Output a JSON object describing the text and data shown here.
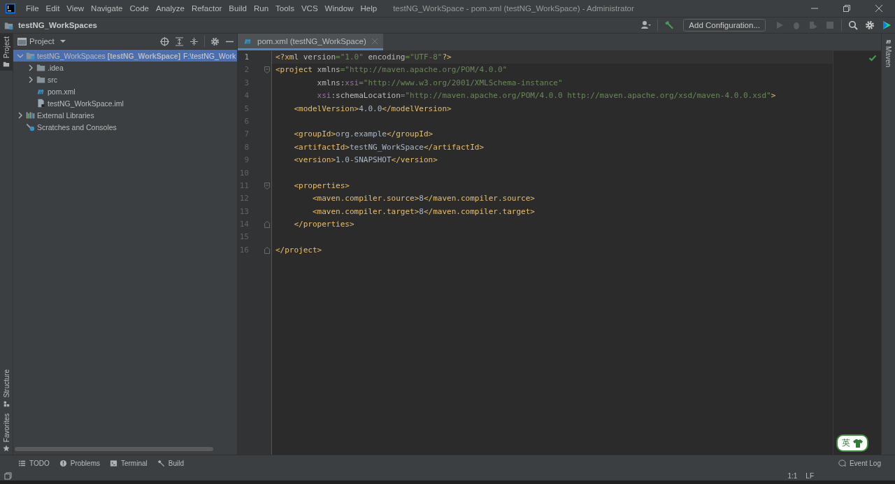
{
  "window": {
    "menu": [
      "File",
      "Edit",
      "View",
      "Navigate",
      "Code",
      "Analyze",
      "Refactor",
      "Build",
      "Run",
      "Tools",
      "VCS",
      "Window",
      "Help"
    ],
    "title": "testNG_WorkSpace - pom.xml (testNG_WorkSpace) - Administrator"
  },
  "navbar": {
    "project": "testNG_WorkSpaces",
    "run_config": "Add Configuration..."
  },
  "left_stripe": [
    {
      "label": "Project",
      "selected": true,
      "kind": "project"
    },
    {
      "label": "Structure",
      "selected": false,
      "kind": "structure"
    },
    {
      "label": "Favorites",
      "selected": false,
      "kind": "favorites"
    }
  ],
  "project_panel": {
    "title": "Project",
    "tree": [
      {
        "name": "testNG_WorkSpaces",
        "module": "[testNG_WorkSpace]",
        "path": "F:\\testNG_Work",
        "kind": "module",
        "expanded": true,
        "selected": true,
        "children": [
          {
            "name": ".idea",
            "kind": "folder",
            "expanded": false,
            "selected": false
          },
          {
            "name": "src",
            "kind": "folder",
            "expanded": false,
            "selected": false
          },
          {
            "name": "pom.xml",
            "kind": "maven",
            "selected": false
          },
          {
            "name": "testNG_WorkSpace.iml",
            "kind": "file",
            "selected": false
          }
        ]
      },
      {
        "name": "External Libraries",
        "kind": "libraries",
        "expanded": false,
        "selected": false
      },
      {
        "name": "Scratches and Consoles",
        "kind": "scratches",
        "selected": false
      }
    ]
  },
  "editor": {
    "tabs": [
      {
        "label": "pom.xml (testNG_WorkSpace)",
        "selected": true
      }
    ],
    "lines": [
      {
        "number": "1",
        "kind": "plain",
        "current": true,
        "tokens": [
          {
            "kind": "tag",
            "text": "<?xml "
          },
          {
            "kind": "attr",
            "text": "version"
          },
          {
            "kind": "str",
            "text": "=\"1.0\""
          },
          {
            "kind": "attr",
            "text": " encoding"
          },
          {
            "kind": "str",
            "text": "=\"UTF-8\""
          },
          {
            "kind": "tag",
            "text": "?>"
          }
        ]
      },
      {
        "number": "2",
        "kind": "fold-start",
        "current": false,
        "tokens": [
          {
            "kind": "tag",
            "text": "<project "
          },
          {
            "kind": "attr",
            "text": "xmlns"
          },
          {
            "kind": "str",
            "text": "=\"http://maven.apache.org/POM/4.0.0\""
          }
        ]
      },
      {
        "number": "3",
        "kind": "plain",
        "current": false,
        "tokens": [
          {
            "kind": "attr",
            "text": "         xmlns:"
          },
          {
            "kind": "ns",
            "text": "xsi"
          },
          {
            "kind": "str",
            "text": "=\"http://www.w3.org/2001/XMLSchema-instance\""
          }
        ]
      },
      {
        "number": "4",
        "kind": "plain",
        "current": false,
        "tokens": [
          {
            "kind": "ns",
            "text": "         xsi"
          },
          {
            "kind": "attr",
            "text": ":schemaLocation"
          },
          {
            "kind": "str",
            "text": "=\"http://maven.apache.org/POM/4.0.0 http://maven.apache.org/xsd/maven-4.0.0.xsd\""
          },
          {
            "kind": "tag",
            "text": ">"
          }
        ]
      },
      {
        "number": "5",
        "kind": "plain",
        "current": false,
        "tokens": [
          {
            "kind": "tag",
            "text": "    <modelVersion>"
          },
          {
            "kind": "text",
            "text": "4.0.0"
          },
          {
            "kind": "tag",
            "text": "</modelVersion>"
          }
        ]
      },
      {
        "number": "6",
        "kind": "plain",
        "current": false
      },
      {
        "number": "7",
        "kind": "plain",
        "current": false,
        "tokens": [
          {
            "kind": "tag",
            "text": "    <groupId>"
          },
          {
            "kind": "text",
            "text": "org.example"
          },
          {
            "kind": "tag",
            "text": "</groupId>"
          }
        ]
      },
      {
        "number": "8",
        "kind": "plain",
        "current": false,
        "tokens": [
          {
            "kind": "tag",
            "text": "    <artifactId>"
          },
          {
            "kind": "text",
            "text": "testNG_WorkSpace"
          },
          {
            "kind": "tag",
            "text": "</artifactId>"
          }
        ]
      },
      {
        "number": "9",
        "kind": "plain",
        "current": false,
        "tokens": [
          {
            "kind": "tag",
            "text": "    <version>"
          },
          {
            "kind": "text",
            "text": "1.0-SNAPSHOT"
          },
          {
            "kind": "tag",
            "text": "</version>"
          }
        ]
      },
      {
        "number": "10",
        "kind": "plain",
        "current": false
      },
      {
        "number": "11",
        "kind": "fold-start",
        "current": false,
        "tokens": [
          {
            "kind": "tag",
            "text": "    <properties>"
          }
        ]
      },
      {
        "number": "12",
        "kind": "plain",
        "current": false,
        "tokens": [
          {
            "kind": "tag",
            "text": "        <maven.compiler.source>"
          },
          {
            "kind": "text",
            "text": "8"
          },
          {
            "kind": "tag",
            "text": "</maven.compiler.source>"
          }
        ]
      },
      {
        "number": "13",
        "kind": "plain",
        "current": false,
        "tokens": [
          {
            "kind": "tag",
            "text": "        <maven.compiler.target>"
          },
          {
            "kind": "text",
            "text": "8"
          },
          {
            "kind": "tag",
            "text": "</maven.compiler.target>"
          }
        ]
      },
      {
        "number": "14",
        "kind": "fold-end",
        "current": false,
        "tokens": [
          {
            "kind": "tag",
            "text": "    </properties>"
          }
        ]
      },
      {
        "number": "15",
        "kind": "plain",
        "current": false
      },
      {
        "number": "16",
        "kind": "fold-end",
        "current": false,
        "tokens": [
          {
            "kind": "tag",
            "text": "</project>"
          }
        ]
      }
    ]
  },
  "right_stripe": [
    {
      "label": "Maven"
    }
  ],
  "ime": {
    "label": "英"
  },
  "bottom_tabs": [
    {
      "label": "TODO",
      "kind": "todo"
    },
    {
      "label": "Problems",
      "kind": "problems"
    },
    {
      "label": "Terminal",
      "kind": "terminal"
    },
    {
      "label": "Build",
      "kind": "build"
    }
  ],
  "event_log": "Event Log",
  "status_bar": [
    "1:1",
    "LF"
  ]
}
